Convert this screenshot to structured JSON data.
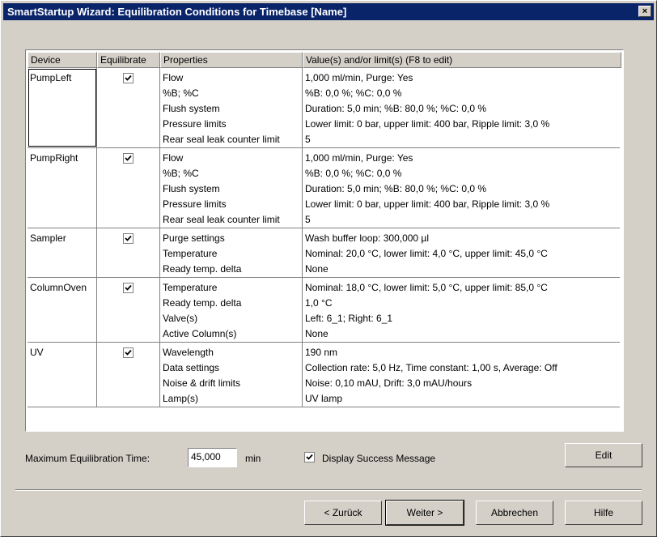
{
  "window": {
    "title": "SmartStartup Wizard: Equilibration Conditions for Timebase [Name]",
    "close_label": "×"
  },
  "table": {
    "headers": [
      "Device",
      "Equilibrate",
      "Properties",
      "Value(s) and/or limit(s) (F8 to edit)"
    ],
    "rows": [
      {
        "device": "PumpLeft",
        "equilibrate": true,
        "properties": [
          "Flow",
          "%B; %C",
          "Flush system",
          "Pressure limits",
          "Rear seal leak counter limit"
        ],
        "values": [
          "1,000 ml/min, Purge: Yes",
          "%B: 0,0 %; %C: 0,0 %",
          "Duration: 5,0 min; %B: 80,0 %; %C: 0,0 %",
          "Lower limit: 0 bar, upper limit: 400 bar, Ripple limit: 3,0 %",
          "5"
        ]
      },
      {
        "device": "PumpRight",
        "equilibrate": true,
        "properties": [
          "Flow",
          "%B; %C",
          "Flush system",
          "Pressure limits",
          "Rear seal leak counter limit"
        ],
        "values": [
          "1,000 ml/min, Purge: Yes",
          "%B: 0,0 %; %C: 0,0 %",
          "Duration: 5,0 min; %B: 80,0 %; %C: 0,0 %",
          "Lower limit: 0 bar, upper limit: 400 bar, Ripple limit: 3,0 %",
          "5"
        ]
      },
      {
        "device": "Sampler",
        "equilibrate": true,
        "properties": [
          "Purge settings",
          "Temperature",
          "Ready temp. delta"
        ],
        "values": [
          "Wash buffer loop: 300,000 µl",
          "Nominal: 20,0 °C, lower limit: 4,0 °C, upper limit: 45,0 °C",
          "None"
        ]
      },
      {
        "device": "ColumnOven",
        "equilibrate": true,
        "properties": [
          "Temperature",
          "Ready temp. delta",
          "Valve(s)",
          "Active Column(s)"
        ],
        "values": [
          "Nominal: 18,0 °C, lower limit: 5,0 °C, upper limit: 85,0 °C",
          "1,0 °C",
          "Left: 6_1; Right: 6_1",
          "None"
        ]
      },
      {
        "device": "UV",
        "equilibrate": true,
        "properties": [
          "Wavelength",
          "Data settings",
          "Noise & drift limits",
          "Lamp(s)"
        ],
        "values": [
          "190 nm",
          "Collection rate: 5,0 Hz, Time constant: 1,00 s, Average: Off",
          "Noise: 0,10 mAU, Drift: 3,0 mAU/hours",
          "UV lamp"
        ]
      }
    ]
  },
  "options": {
    "max_time_label": "Maximum Equilibration Time:",
    "max_time_value": "45,000",
    "max_time_unit": "min",
    "display_success_label": "Display Success Message",
    "display_success_checked": true,
    "edit_label": "Edit"
  },
  "buttons": {
    "back": "< Zurück",
    "next": "Weiter >",
    "cancel": "Abbrechen",
    "help": "Hilfe"
  }
}
